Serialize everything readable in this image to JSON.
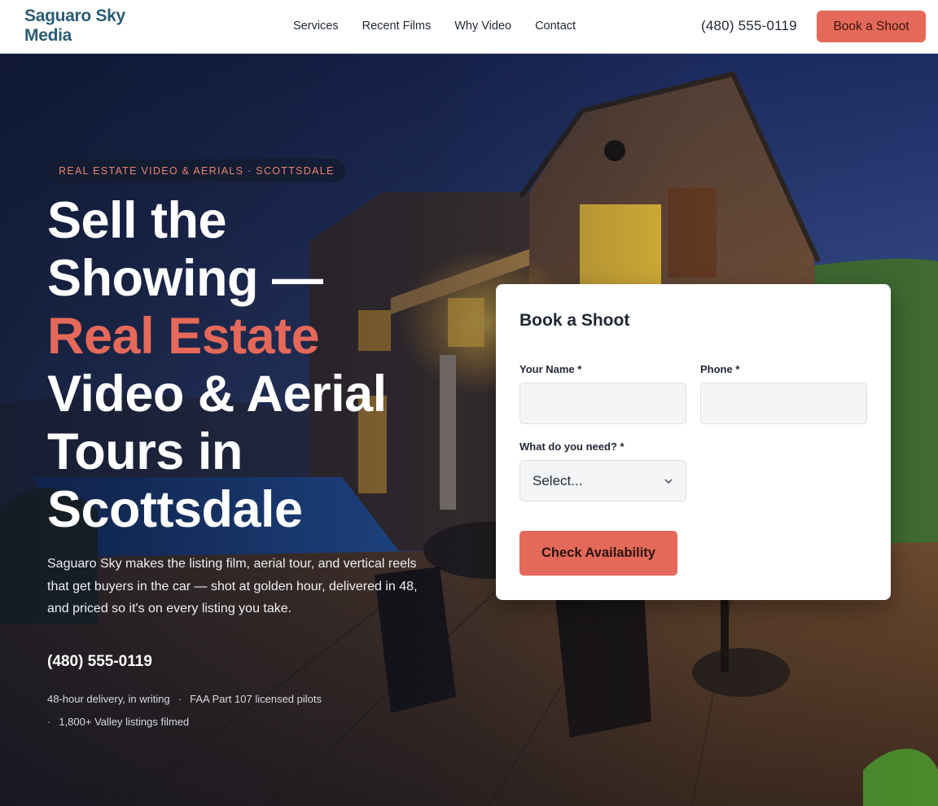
{
  "header": {
    "logo": "Saguaro Sky Media",
    "nav": [
      {
        "label": "Services"
      },
      {
        "label": "Recent Films"
      },
      {
        "label": "Why Video"
      },
      {
        "label": "Contact"
      }
    ],
    "phone": "(480) 555-0119",
    "cta_label": "Book a Shoot"
  },
  "hero": {
    "eyebrow": "REAL ESTATE VIDEO & AERIALS · SCOTTSDALE",
    "headline_line1": "Sell the",
    "headline_line2": "Showing —",
    "headline_accent": "Real Estate",
    "headline_line4": "Video & Aerial",
    "headline_line5": "Tours in",
    "headline_line6": "Scottsdale",
    "lede": "Saguaro Sky makes the listing film, aerial tour, and vertical reels that get buyers in the car — shot at golden hour, delivered in 48, and priced so it's on every listing you take.",
    "phone": "(480) 555-0119",
    "trust": [
      "48-hour delivery, in writing",
      "FAA Part 107 licensed pilots",
      "1,800+ Valley listings filmed"
    ]
  },
  "form": {
    "title": "Book a Shoot",
    "name_label": "Your Name *",
    "name_value": "",
    "phone_label": "Phone *",
    "phone_value": "",
    "need_label": "What do you need? *",
    "need_selected": "Select...",
    "submit_label": "Check Availability"
  },
  "colors": {
    "accent": "#e5695a",
    "brand": "#2c5c75",
    "navy": "#1f2733"
  }
}
